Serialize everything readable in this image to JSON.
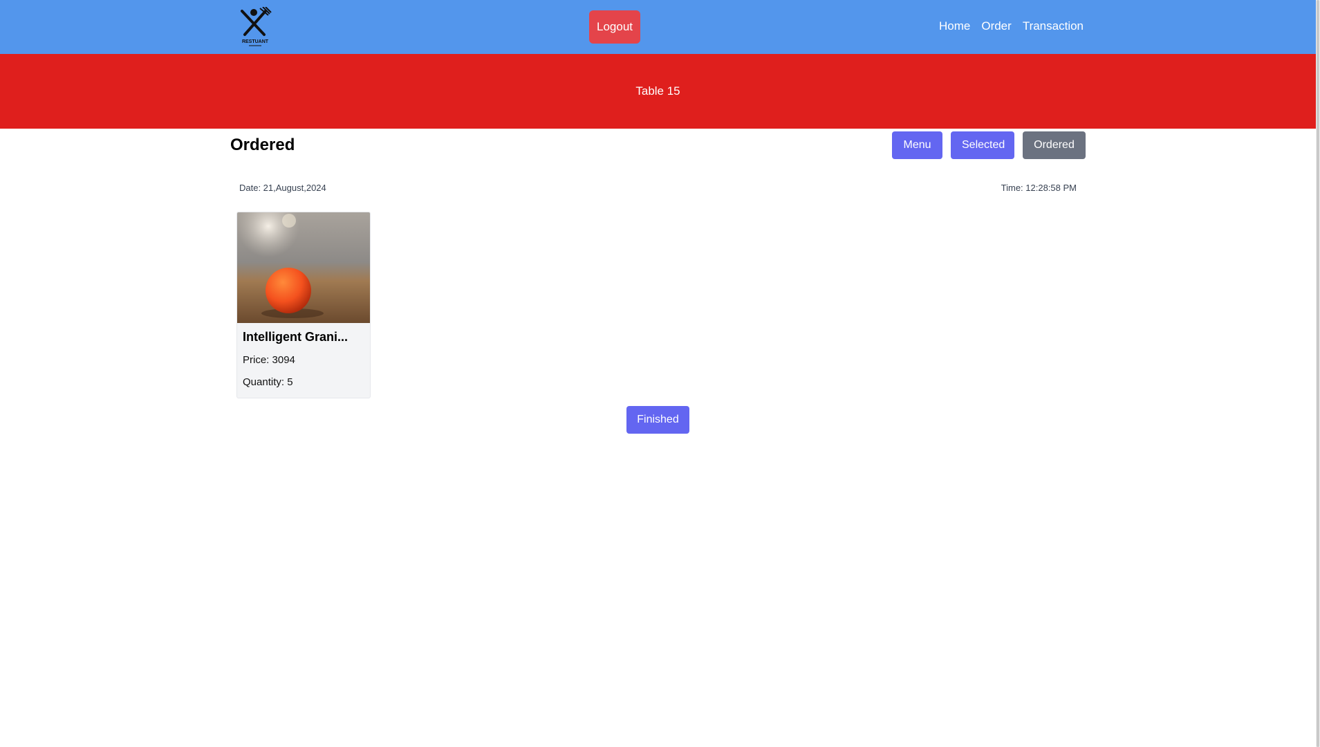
{
  "header": {
    "logo_text": "RESTUANT",
    "logout_label": "Logout",
    "nav": [
      "Home",
      "Order",
      "Transaction"
    ]
  },
  "banner": {
    "table_label": "Table 15"
  },
  "main": {
    "title": "Ordered",
    "buttons": {
      "menu": "Menu",
      "selected": "Selected",
      "ordered": "Ordered"
    },
    "date": "Date: 21,August,2024",
    "time": "Time: 12:28:58 PM"
  },
  "items": [
    {
      "name": "Intelligent Grani...",
      "price": "Price: 3094",
      "quantity": "Quantity: 5"
    }
  ],
  "finished_label": "Finished",
  "colors": {
    "navbar": "#5396ec",
    "banner": "#df1f1d",
    "logout": "#e4444a",
    "primary": "#6366f1",
    "ordered": "#6b7280"
  },
  "icons": {
    "logo": "fork-knife-logo-icon",
    "card_image": "orange-ball-image"
  }
}
